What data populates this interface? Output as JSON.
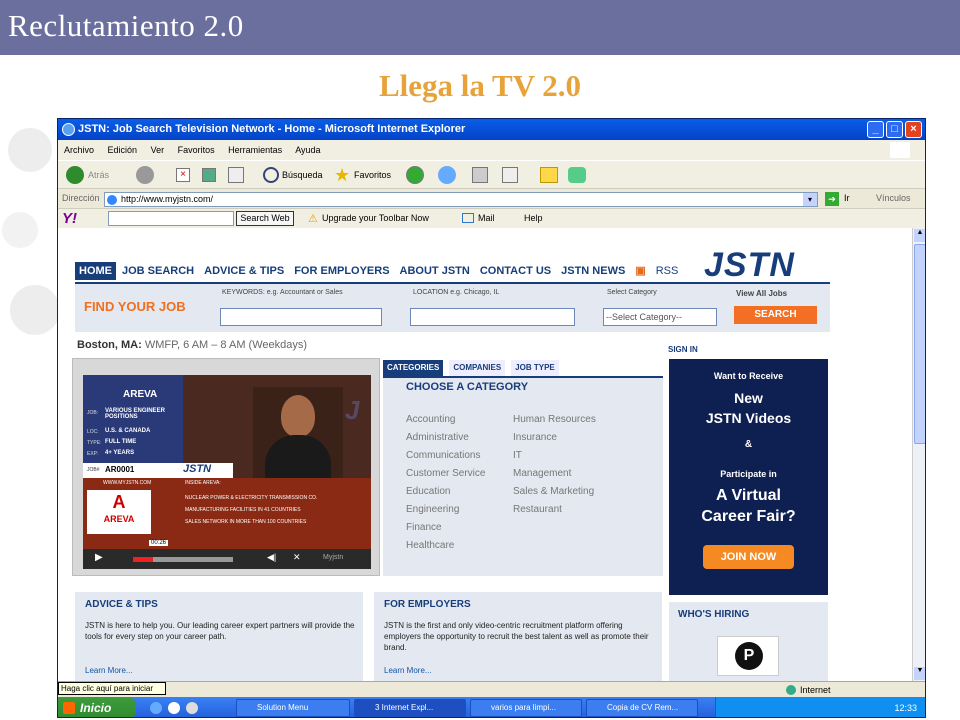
{
  "slide": {
    "title": "Reclutamiento 2.0",
    "subtitle": "Llega la TV 2.0"
  },
  "browser": {
    "window_title": "JSTN: Job Search Television Network - Home - Microsoft Internet Explorer",
    "menu": [
      "Archivo",
      "Edición",
      "Ver",
      "Favoritos",
      "Herramientas",
      "Ayuda"
    ],
    "toolbar": {
      "back_label": "Atrás",
      "search_label": "Búsqueda",
      "favorites_label": "Favoritos"
    },
    "address": {
      "label": "Dirección",
      "url": "http://www.myjstn.com/",
      "go_label": "Ir",
      "links_label": "Vínculos"
    },
    "yahoo_toolbar": {
      "search_button": "Search Web",
      "upgrade_label": "Upgrade your Toolbar Now",
      "mail_label": "Mail",
      "help_label": "Help"
    },
    "status": {
      "zone": "Internet",
      "tooltip": "Haga clic aquí para iniciar"
    }
  },
  "taskbar": {
    "start_label": "Inicio",
    "tasks": [
      "Solution Menu",
      "3 Internet Expl...",
      "varios para limpi...",
      "Copia de CV Rem..."
    ],
    "clock": "12:33"
  },
  "site": {
    "logo": "JSTN",
    "nav": [
      "HOME",
      "JOB SEARCH",
      "ADVICE & TIPS",
      "FOR EMPLOYERS",
      "ABOUT JSTN",
      "CONTACT US",
      "JSTN NEWS",
      "RSS"
    ],
    "search": {
      "heading": "FIND YOUR JOB",
      "keywords_label": "KEYWORDS: e.g. Accountant or Sales",
      "location_label": "LOCATION e.g. Chicago, IL",
      "category_label": "Select Category",
      "category_value": "--Select Category--",
      "view_all": "View All Jobs",
      "search_button": "SEARCH"
    },
    "location_line": {
      "city": "Boston, MA:",
      "detail": "WMFP, 6 AM – 8 AM (Weekdays)"
    },
    "video": {
      "company": "AREVA",
      "job_label": "JOB:",
      "job": "VARIOUS ENGINEER POSITIONS",
      "loc_label": "LOC:",
      "loc": "U.S. & CANADA",
      "type_label": "TYPE:",
      "type": "FULL TIME",
      "exp_label": "EXP:",
      "exp": "4+ YEARS",
      "job_id_label": "JOB#",
      "job_id": "AR0001",
      "brand": "JSTN",
      "url_strip": "WWW.MYJSTN.COM",
      "inside": "INSIDE AREVA:",
      "bullets": [
        "NUCLEAR POWER & ELECTRICITY TRANSMISSION CO.",
        "MANUFACTURING FACILITIES IN 41 COUNTRIES",
        "SALES NETWORK IN MORE THAN 100 COUNTRIES"
      ],
      "time": "00:26",
      "player_brand": "Myjstn",
      "progress": 0.2
    },
    "category_tabs": [
      "CATEGORIES",
      "COMPANIES",
      "JOB TYPE"
    ],
    "category_heading": "CHOOSE A CATEGORY",
    "categories_left": [
      "Accounting",
      "Administrative",
      "Communications",
      "Customer Service",
      "Education",
      "Engineering",
      "Finance",
      "Healthcare"
    ],
    "categories_right": [
      "Human Resources",
      "Insurance",
      "IT",
      "Management",
      "Sales & Marketing",
      "Restaurant"
    ],
    "sign_in": "SIGN IN",
    "promo": {
      "line1": "Want to Receive",
      "line2": "New",
      "line3": "JSTN Videos",
      "line4": "&",
      "line5": "Participate in",
      "line6": "A Virtual",
      "line7": "Career Fair?",
      "button": "JOIN NOW"
    },
    "advice": {
      "heading": "ADVICE & TIPS",
      "body": "JSTN is here to help you. Our leading career expert partners will provide the tools for every step on your career path.",
      "more": "Learn More..."
    },
    "employers": {
      "heading": "FOR EMPLOYERS",
      "body": "JSTN is the first and only video-centric recruitment platform offering employers the opportunity to recruit the best talent as well as promote their brand.",
      "more": "Learn More..."
    },
    "who_hiring": "WHO'S HIRING"
  },
  "colors": {
    "slide_header": "#6b6f9e",
    "subtitle": "#e8a23a",
    "site_navy": "#173d7b",
    "site_orange": "#f36f24"
  }
}
